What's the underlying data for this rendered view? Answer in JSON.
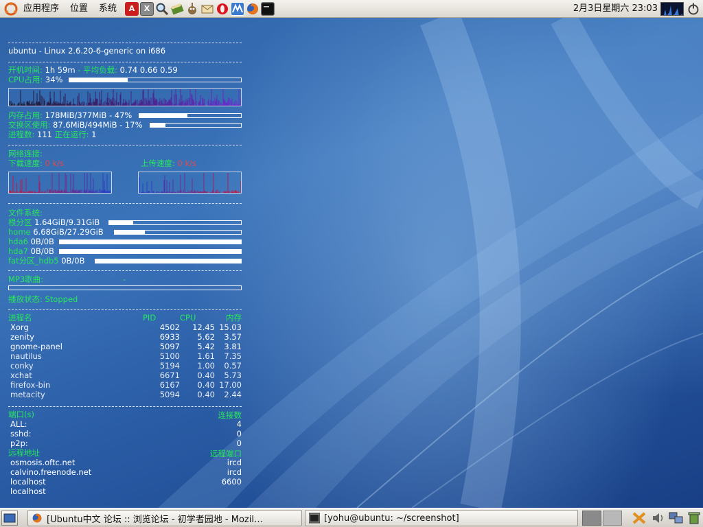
{
  "top_panel": {
    "menus": [
      "应用程序",
      "位置",
      "系统"
    ],
    "launchers": [
      "adobe-reader-icon",
      "font-viewer-icon",
      "search-tool-icon",
      "dictionary-icon",
      "gimp-icon",
      "mail-icon",
      "opera-icon",
      "dia-icon",
      "firefox-icon",
      "terminal-icon"
    ],
    "clock": "2月3日星期六 23:03"
  },
  "conky": {
    "system_line": "ubuntu - Linux 2.6.20-6-generic on i686",
    "uptime_label": "开机时间:",
    "uptime_value": "1h 59m",
    "load_label": "- 平均负载:",
    "load_value": "0.74 0.66 0.59",
    "cpu_label": "CPU占用:",
    "cpu_value": "34%",
    "cpu_fraction": 0.34,
    "mem_label": "内存占用:",
    "mem_value": "178MiB/377MiB - 47%",
    "mem_fraction": 0.47,
    "swap_label": "交换区使用:",
    "swap_value": "87.6MiB/494MiB - 17%",
    "swap_fraction": 0.17,
    "proc_label": "进程数:",
    "proc_value": "111",
    "running_label": "正在运行:",
    "running_value": "1",
    "net_title": "网络连接:",
    "down_label": "下载速度:",
    "down_value": "0 k/s",
    "up_label": "上传速度:",
    "up_value": "0 k/s",
    "fs_title": "文件系统:",
    "filesystems": [
      {
        "name": "根分区",
        "value": "1.64GiB/9.31GiB",
        "fraction": 0.18
      },
      {
        "name": "home",
        "value": "6.68GiB/27.29GiB",
        "fraction": 0.24
      },
      {
        "name": "hda6",
        "value": "0B/0B",
        "fraction": 1.0
      },
      {
        "name": "hda7",
        "value": "0B/0B",
        "fraction": 1.0
      },
      {
        "name": "fat分区_hdb5",
        "value": "0B/0B",
        "fraction": 1.0
      }
    ],
    "mp3_label": "MP3歌曲:",
    "mp3_value": "-",
    "play_label": "播放状态:",
    "play_value": "Stopped",
    "proc_headers": [
      "进程名",
      "PID",
      "CPU",
      "内存"
    ],
    "processes": [
      {
        "name": "Xorg",
        "pid": "4502",
        "cpu": "12.45",
        "mem": "15.03"
      },
      {
        "name": "zenity",
        "pid": "6933",
        "cpu": "5.62",
        "mem": "3.57"
      },
      {
        "name": "gnome-panel",
        "pid": "5097",
        "cpu": "5.42",
        "mem": "3.81"
      },
      {
        "name": "nautilus",
        "pid": "5100",
        "cpu": "1.61",
        "mem": "7.35"
      },
      {
        "name": "conky",
        "pid": "5194",
        "cpu": "1.00",
        "mem": "0.57"
      },
      {
        "name": "xchat",
        "pid": "6671",
        "cpu": "0.40",
        "mem": "5.73"
      },
      {
        "name": "firefox-bin",
        "pid": "6167",
        "cpu": "0.40",
        "mem": "17.00"
      },
      {
        "name": "metacity",
        "pid": "5094",
        "cpu": "0.40",
        "mem": "2.44"
      }
    ],
    "ports_label": "端口(s)",
    "conn_label": "连接数",
    "ports": [
      {
        "name": "ALL:",
        "count": "4"
      },
      {
        "name": "sshd:",
        "count": "0"
      },
      {
        "name": "p2p:",
        "count": "0"
      }
    ],
    "remote_addr_label": "远程地址",
    "remote_port_label": "远程端口",
    "remotes": [
      {
        "addr": "osmosis.oftc.net",
        "port": "ircd"
      },
      {
        "addr": "calvino.freenode.net",
        "port": "ircd"
      },
      {
        "addr": "localhost",
        "port": "6600"
      },
      {
        "addr": "localhost",
        "port": ""
      }
    ]
  },
  "taskbar": {
    "tasks": [
      {
        "icon": "firefox-icon",
        "label": "[Ubuntu中文 论坛 :: 浏览论坛 - 初学者园地 - Mozil…"
      },
      {
        "icon": "terminal-icon",
        "label": "[yohu@ubuntu: ~/screenshot]"
      }
    ]
  },
  "colors": {
    "conky_label": "#26e85a",
    "conky_value": "#ffffff",
    "net_speed": "#e04a4a",
    "cpu_graph_start": "#1a1a30",
    "cpu_graph_end": "#6a2fd0",
    "down_graph": "#d0143c",
    "up_graph": "#2040d0"
  }
}
